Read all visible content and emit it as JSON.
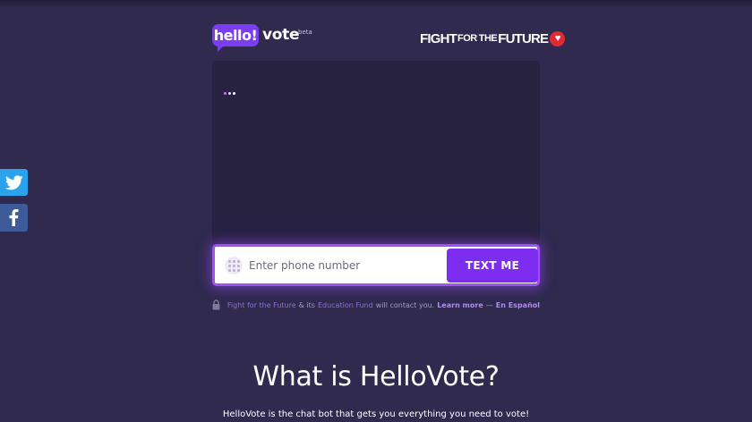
{
  "header": {
    "logo_hello": "hello!",
    "logo_vote": "vote",
    "logo_beta": "beta",
    "partner_logo": {
      "part1": "FIGHT",
      "part2": "FOR",
      "part3": "THE",
      "part4": "FUTURE",
      "icon": "heart-icon",
      "badge_color": "#e02a35"
    }
  },
  "chat": {
    "typing_indicator": "typing-dots-icon"
  },
  "form": {
    "phone_placeholder": "Enter phone number",
    "phone_value": "",
    "submit_label": "TEXT ME",
    "accent_color": "#7d2df0"
  },
  "disclaimer": {
    "org_link": "Fight for the Future",
    "and_its": "& its",
    "fund_link": "Education Fund",
    "will_contact": "will contact you.",
    "learn_more": "Learn more",
    "dash": "—",
    "spanish_link": "En Español"
  },
  "main": {
    "headline": "What is HelloVote?",
    "subtext": "HelloVote is the chat bot that gets you everything you need to vote!"
  },
  "social": {
    "twitter": "twitter-icon",
    "facebook": "facebook-icon",
    "twitter_color": "#2aa3ec",
    "facebook_color": "#3d5a99"
  }
}
